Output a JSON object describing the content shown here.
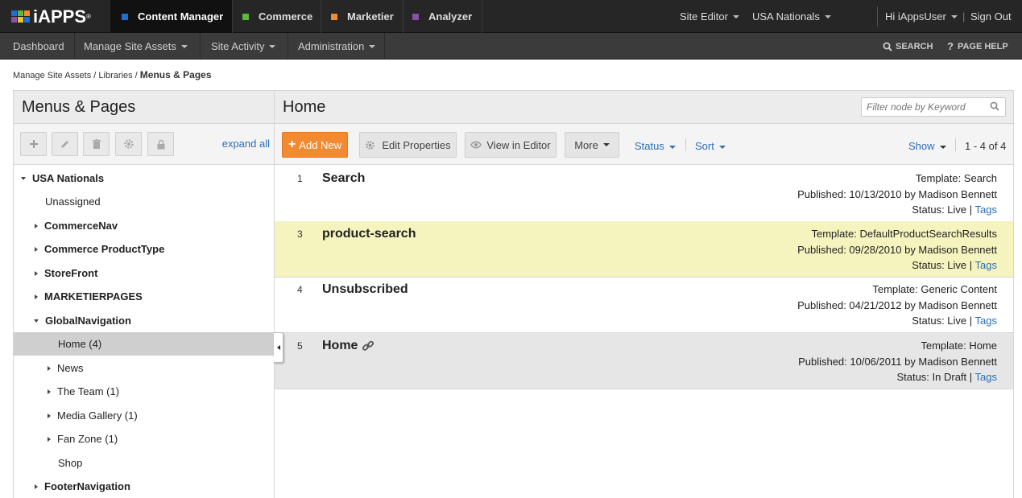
{
  "brand": {
    "name": "iAPPS",
    "reg": "®"
  },
  "apps": [
    {
      "label": "Content Manager",
      "color": "#1f6fd1"
    },
    {
      "label": "Commerce",
      "color": "#5fb83a"
    },
    {
      "label": "Marketier",
      "color": "#f08a35"
    },
    {
      "label": "Analyzer",
      "color": "#8a4fa8"
    }
  ],
  "top_right": {
    "site_editor": "Site Editor",
    "site": "USA Nationals",
    "user": "Hi iAppsUser",
    "signout": "Sign Out"
  },
  "nav": {
    "items": [
      "Dashboard",
      "Manage Site Assets",
      "Site Activity",
      "Administration"
    ],
    "search": "SEARCH",
    "help": "PAGE HELP"
  },
  "breadcrumb": {
    "part1": "Manage Site Assets",
    "sep": "/",
    "part2": "Libraries",
    "current": "Menus & Pages"
  },
  "left": {
    "title": "Menus & Pages",
    "expand_all": "expand all",
    "tree": [
      {
        "label": "USA Nationals",
        "expander": "down",
        "bold": true
      },
      {
        "label": "Unassigned",
        "expander": "none",
        "bold": false
      },
      {
        "label": "CommerceNav",
        "expander": "right",
        "bold": true
      },
      {
        "label": "Commerce ProductType",
        "expander": "right",
        "bold": true
      },
      {
        "label": "StoreFront",
        "expander": "right",
        "bold": true
      },
      {
        "label": "MARKETIERPAGES",
        "expander": "right",
        "bold": true
      },
      {
        "label": "GlobalNavigation",
        "expander": "down",
        "bold": true
      },
      {
        "label": "Home (4)",
        "expander": "none",
        "bold": false,
        "selected": true
      },
      {
        "label": "News",
        "expander": "right",
        "bold": false
      },
      {
        "label": "The Team (1)",
        "expander": "right",
        "bold": false
      },
      {
        "label": "Media Gallery (1)",
        "expander": "right",
        "bold": false
      },
      {
        "label": "Fan Zone (1)",
        "expander": "right",
        "bold": false
      },
      {
        "label": "Shop",
        "expander": "none",
        "bold": false
      },
      {
        "label": "FooterNavigation",
        "expander": "right",
        "bold": true
      }
    ]
  },
  "right": {
    "title": "Home",
    "filter_placeholder": "Filter node by Keyword",
    "buttons": {
      "add": "Add New",
      "edit": "Edit Properties",
      "view": "View in Editor",
      "more": "More"
    },
    "status": "Status",
    "sort": "Sort",
    "show": "Show",
    "count": "1 - 4 of 4",
    "rows": [
      {
        "num": "1",
        "name": "Search",
        "template": "Template: Search",
        "published": "Published: 10/13/2010 by Madison Bennett",
        "status": "Status: Live",
        "tags": "Tags",
        "linked": false
      },
      {
        "num": "3",
        "name": "product-search",
        "template": "Template: DefaultProductSearchResults",
        "published": "Published: 09/28/2010 by Madison Bennett",
        "status": "Status: Live",
        "tags": "Tags",
        "linked": false
      },
      {
        "num": "4",
        "name": "Unsubscribed",
        "template": "Template: Generic Content",
        "published": "Published: 04/21/2012 by Madison Bennett",
        "status": "Status: Live",
        "tags": "Tags",
        "linked": false
      },
      {
        "num": "5",
        "name": "Home",
        "template": "Template: Home",
        "published": "Published: 10/06/2011 by Madison Bennett",
        "status": "Status: In Draft",
        "tags": "Tags",
        "linked": true
      }
    ]
  }
}
